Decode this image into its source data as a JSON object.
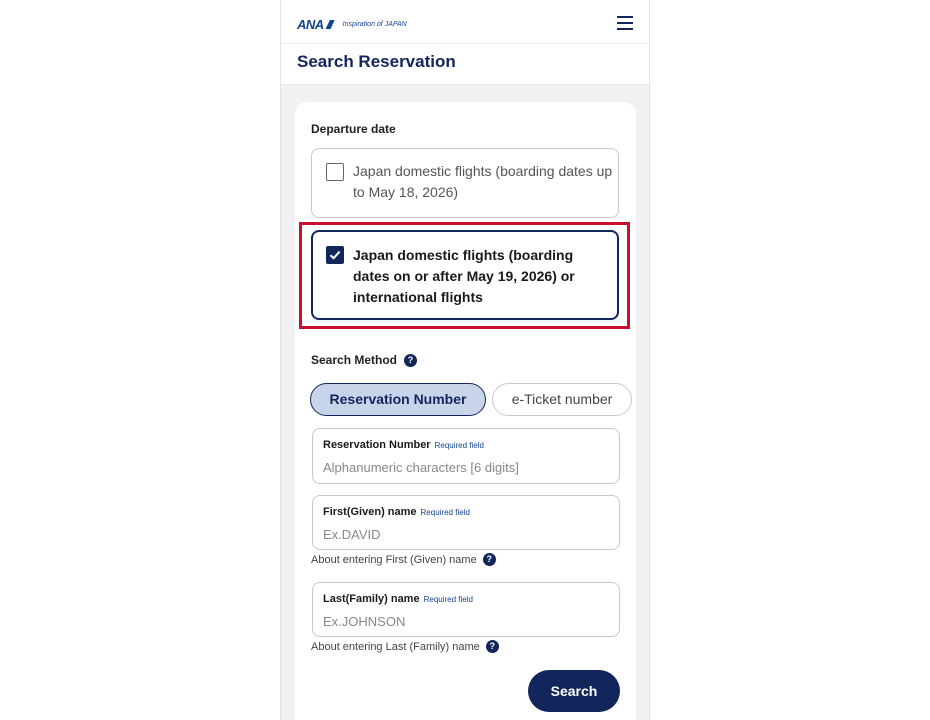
{
  "header": {
    "logo_text": "ANA",
    "tagline": "Inspiration of JAPAN",
    "menu_icon": "hamburger-menu-icon"
  },
  "page": {
    "title": "Search Reservation"
  },
  "departure": {
    "label": "Departure date",
    "options": [
      {
        "label": "Japan domestic flights (boarding dates up to May 18, 2026)",
        "checked": false
      },
      {
        "label": "Japan domestic flights (boarding dates on or after May 19, 2026) or international flights",
        "checked": true
      }
    ]
  },
  "search_method": {
    "label": "Search Method",
    "help_icon": "?",
    "tabs": [
      {
        "label": "Reservation Number",
        "active": true
      },
      {
        "label": "e-Ticket number",
        "active": false
      }
    ]
  },
  "fields": [
    {
      "label": "Reservation Number",
      "required": "Required field",
      "placeholder": "Alphanumeric characters [6 digits]"
    },
    {
      "label": "First(Given) name",
      "required": "Required field",
      "placeholder": "Ex.DAVID"
    },
    {
      "label": "Last(Family) name",
      "required": "Required field",
      "placeholder": "Ex.JOHNSON"
    }
  ],
  "about_links": [
    {
      "label": "About entering First (Given) name"
    },
    {
      "label": "About entering Last (Family) name"
    }
  ],
  "search_button": {
    "label": "Search"
  },
  "colors": {
    "navy": "#13265c",
    "brand_blue": "#13448f",
    "highlight_red": "#c8102e",
    "pill_active_bg": "#c7d4ea"
  }
}
